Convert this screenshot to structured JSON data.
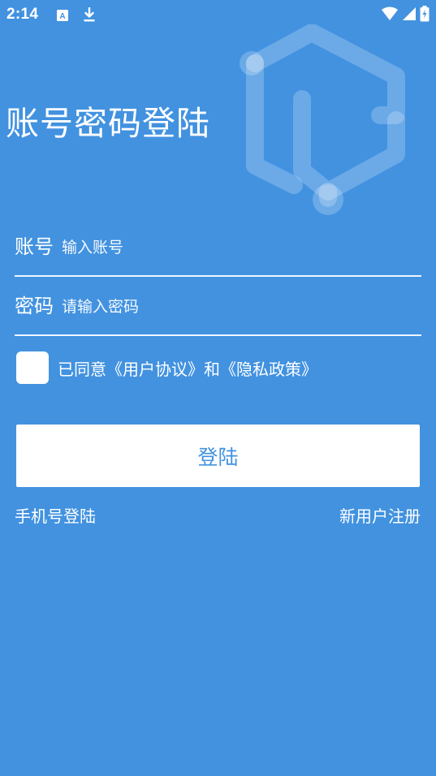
{
  "status_bar": {
    "time": "2:14",
    "icons": [
      "a-notification-icon",
      "download-icon",
      "wifi-icon",
      "signal-icon",
      "battery-charging-icon"
    ]
  },
  "title": "账号密码登陆",
  "account": {
    "label": "账号",
    "placeholder": "输入账号",
    "value": ""
  },
  "password": {
    "label": "密码",
    "placeholder": "请输入密码",
    "value": ""
  },
  "agreement": {
    "checked": false,
    "text": "已同意《用户协议》和《隐私政策》"
  },
  "login_button": "登陆",
  "links": {
    "phone_login": "手机号登陆",
    "register": "新用户注册"
  },
  "colors": {
    "background": "#4292e0",
    "foreground": "#ffffff",
    "button_text": "#4292e0"
  }
}
